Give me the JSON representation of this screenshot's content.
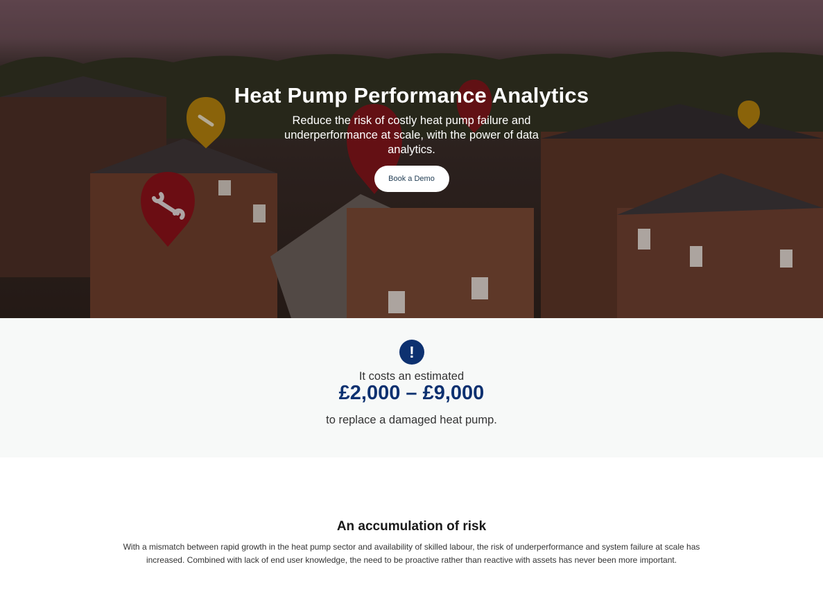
{
  "hero": {
    "title": "Heat Pump Performance Analytics",
    "subtitle": "Reduce the risk of costly heat pump failure and underperformance at scale, with the power of data analytics.",
    "cta_label": "Book a Demo"
  },
  "cost": {
    "icon": "exclamation-icon",
    "pre_text": "It costs an estimated",
    "range": "£2,000 – £9,000",
    "post_text": "to replace a damaged heat pump."
  },
  "risk": {
    "title": "An accumulation of risk",
    "body": "With a mismatch between rapid growth in the heat pump sector and availability of skilled labour, the risk of underperformance and system failure at scale has increased. Combined with lack of end user knowledge, the need to be proactive rather than reactive with assets has never been more important."
  },
  "colors": {
    "brand_navy": "#0d3170",
    "pin_red": "#8c0f17",
    "pin_amber": "#b8860b"
  }
}
